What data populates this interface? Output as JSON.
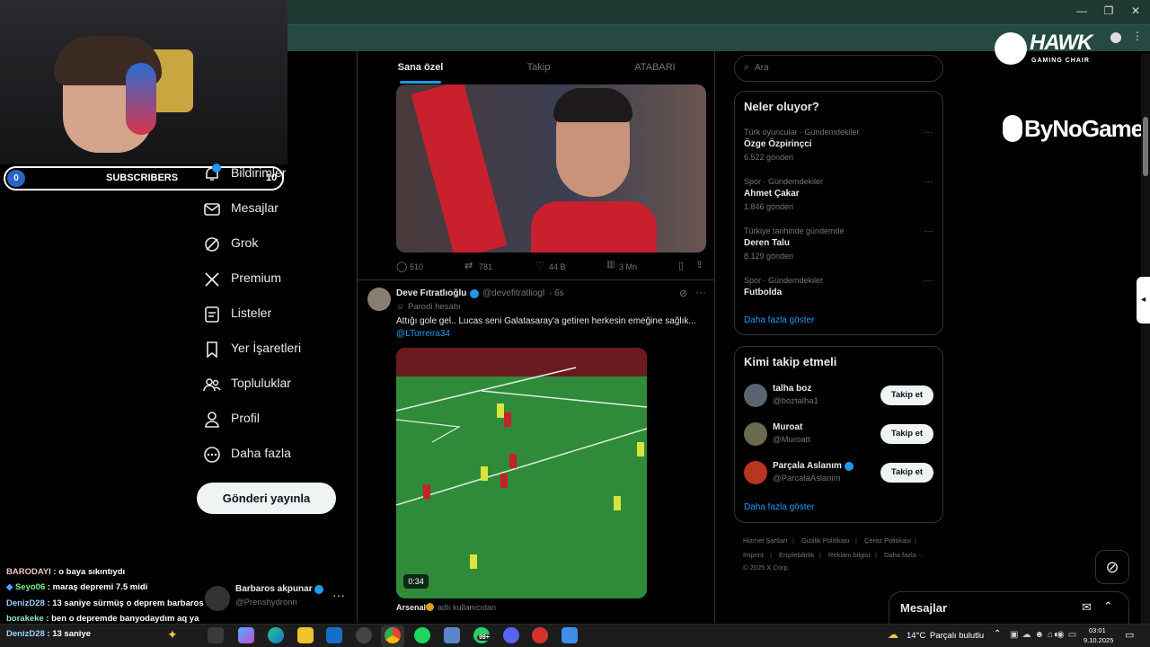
{
  "webcam": {
    "subscribers_label": "SUBSCRIBERS",
    "sub_current": "0",
    "sub_goal": "10"
  },
  "nav": [
    {
      "label": "Bildirimler",
      "icon": "bell-icon"
    },
    {
      "label": "Mesajlar",
      "icon": "envelope-icon"
    },
    {
      "label": "Grok",
      "icon": "grok-icon"
    },
    {
      "label": "Premium",
      "icon": "x-logo-icon"
    },
    {
      "label": "Listeler",
      "icon": "list-icon"
    },
    {
      "label": "Yer İşaretleri",
      "icon": "bookmark-icon"
    },
    {
      "label": "Topluluklar",
      "icon": "communities-icon"
    },
    {
      "label": "Profil",
      "icon": "profile-icon"
    },
    {
      "label": "Daha fazla",
      "icon": "more-circle-icon"
    }
  ],
  "post_button": "Gönderi yayınla",
  "account": {
    "name": "Barbaros akpunar",
    "handle": "@Prenshydronn"
  },
  "chat": [
    {
      "user": "BARODAYI",
      "msg": " : o baya sıkıntıydı"
    },
    {
      "user": "Seyo06",
      "msg": " : maraş depremi 7.5 midi"
    },
    {
      "user": "DenizD28",
      "msg": " : 13 saniye sürmüş o deprem barbaros"
    },
    {
      "user": "borakeke",
      "msg": " : ben o depremde banyodaydım aq ya"
    },
    {
      "user": "DenizD28",
      "msg": " : 13 saniye"
    }
  ],
  "tabs": [
    "Sana özel",
    "Takip",
    "ATABARI"
  ],
  "tweet1_stats": {
    "replies": "510",
    "reposts": "781",
    "likes": "44 B",
    "views": "3 Mn"
  },
  "tweet2": {
    "name": "Deve Fıtratlıoğlu",
    "handle": "@devefitratliogl",
    "time": "· 6s",
    "parody": "Parodi hesabı",
    "text": "Attığı gole gel.. Lucas seni Galatasaray'a getiren herkesin emeğine sağlık...",
    "mention": "@LTorreira34",
    "video_time": "0:34",
    "via_name": "Arsenal",
    "via_text": "adlı kullanıcıdan"
  },
  "search": {
    "placeholder": "Ara"
  },
  "trends": {
    "title": "Neler oluyor?",
    "items": [
      {
        "cat": "Türk oyuncular · Gündemdekiler",
        "name": "Özge Özpirinçci",
        "count": "6.522 gönderi"
      },
      {
        "cat": "Spor · Gündemdekiler",
        "name": "Ahmet Çakar",
        "count": "1.846 gönderi"
      },
      {
        "cat": "Türkiye tarihinde gündemde",
        "name": "Deren Talu",
        "count": "8.129 gönderi"
      },
      {
        "cat": "Spor · Gündemdekiler",
        "name": "Futbolda",
        "count": ""
      }
    ],
    "more": "Daha fazla göster"
  },
  "who_to_follow": {
    "title": "Kimi takip etmeli",
    "items": [
      {
        "name": "talha boz",
        "handle": "@boztalha1",
        "button": "Takip et"
      },
      {
        "name": "Muroat",
        "handle": "@Muroatt",
        "button": "Takip et"
      },
      {
        "name": "Parçala Aslanım",
        "handle": "@ParcalaAslanim",
        "button": "Takip et"
      }
    ],
    "more": "Daha fazla göster"
  },
  "footer": {
    "links": [
      "Hizmet Şartları",
      "Gizlilik Politikası",
      "Çerez Politikası",
      "Imprint",
      "Erişilebilirlik",
      "Reklam bilgisi",
      "Daha fazla ···"
    ],
    "copyright": "© 2025 X Corp."
  },
  "messages_drawer": "Mesajlar",
  "overlays": {
    "hawk": "HAWK",
    "hawk_sub": "GAMING CHAIR",
    "bynogame": "ByNoGame"
  },
  "taskbar": {
    "weather": "14°C",
    "weather_text": "Parçalı bulutlu",
    "time": "03:01",
    "date": "9.10.2025",
    "badge": "99+"
  }
}
